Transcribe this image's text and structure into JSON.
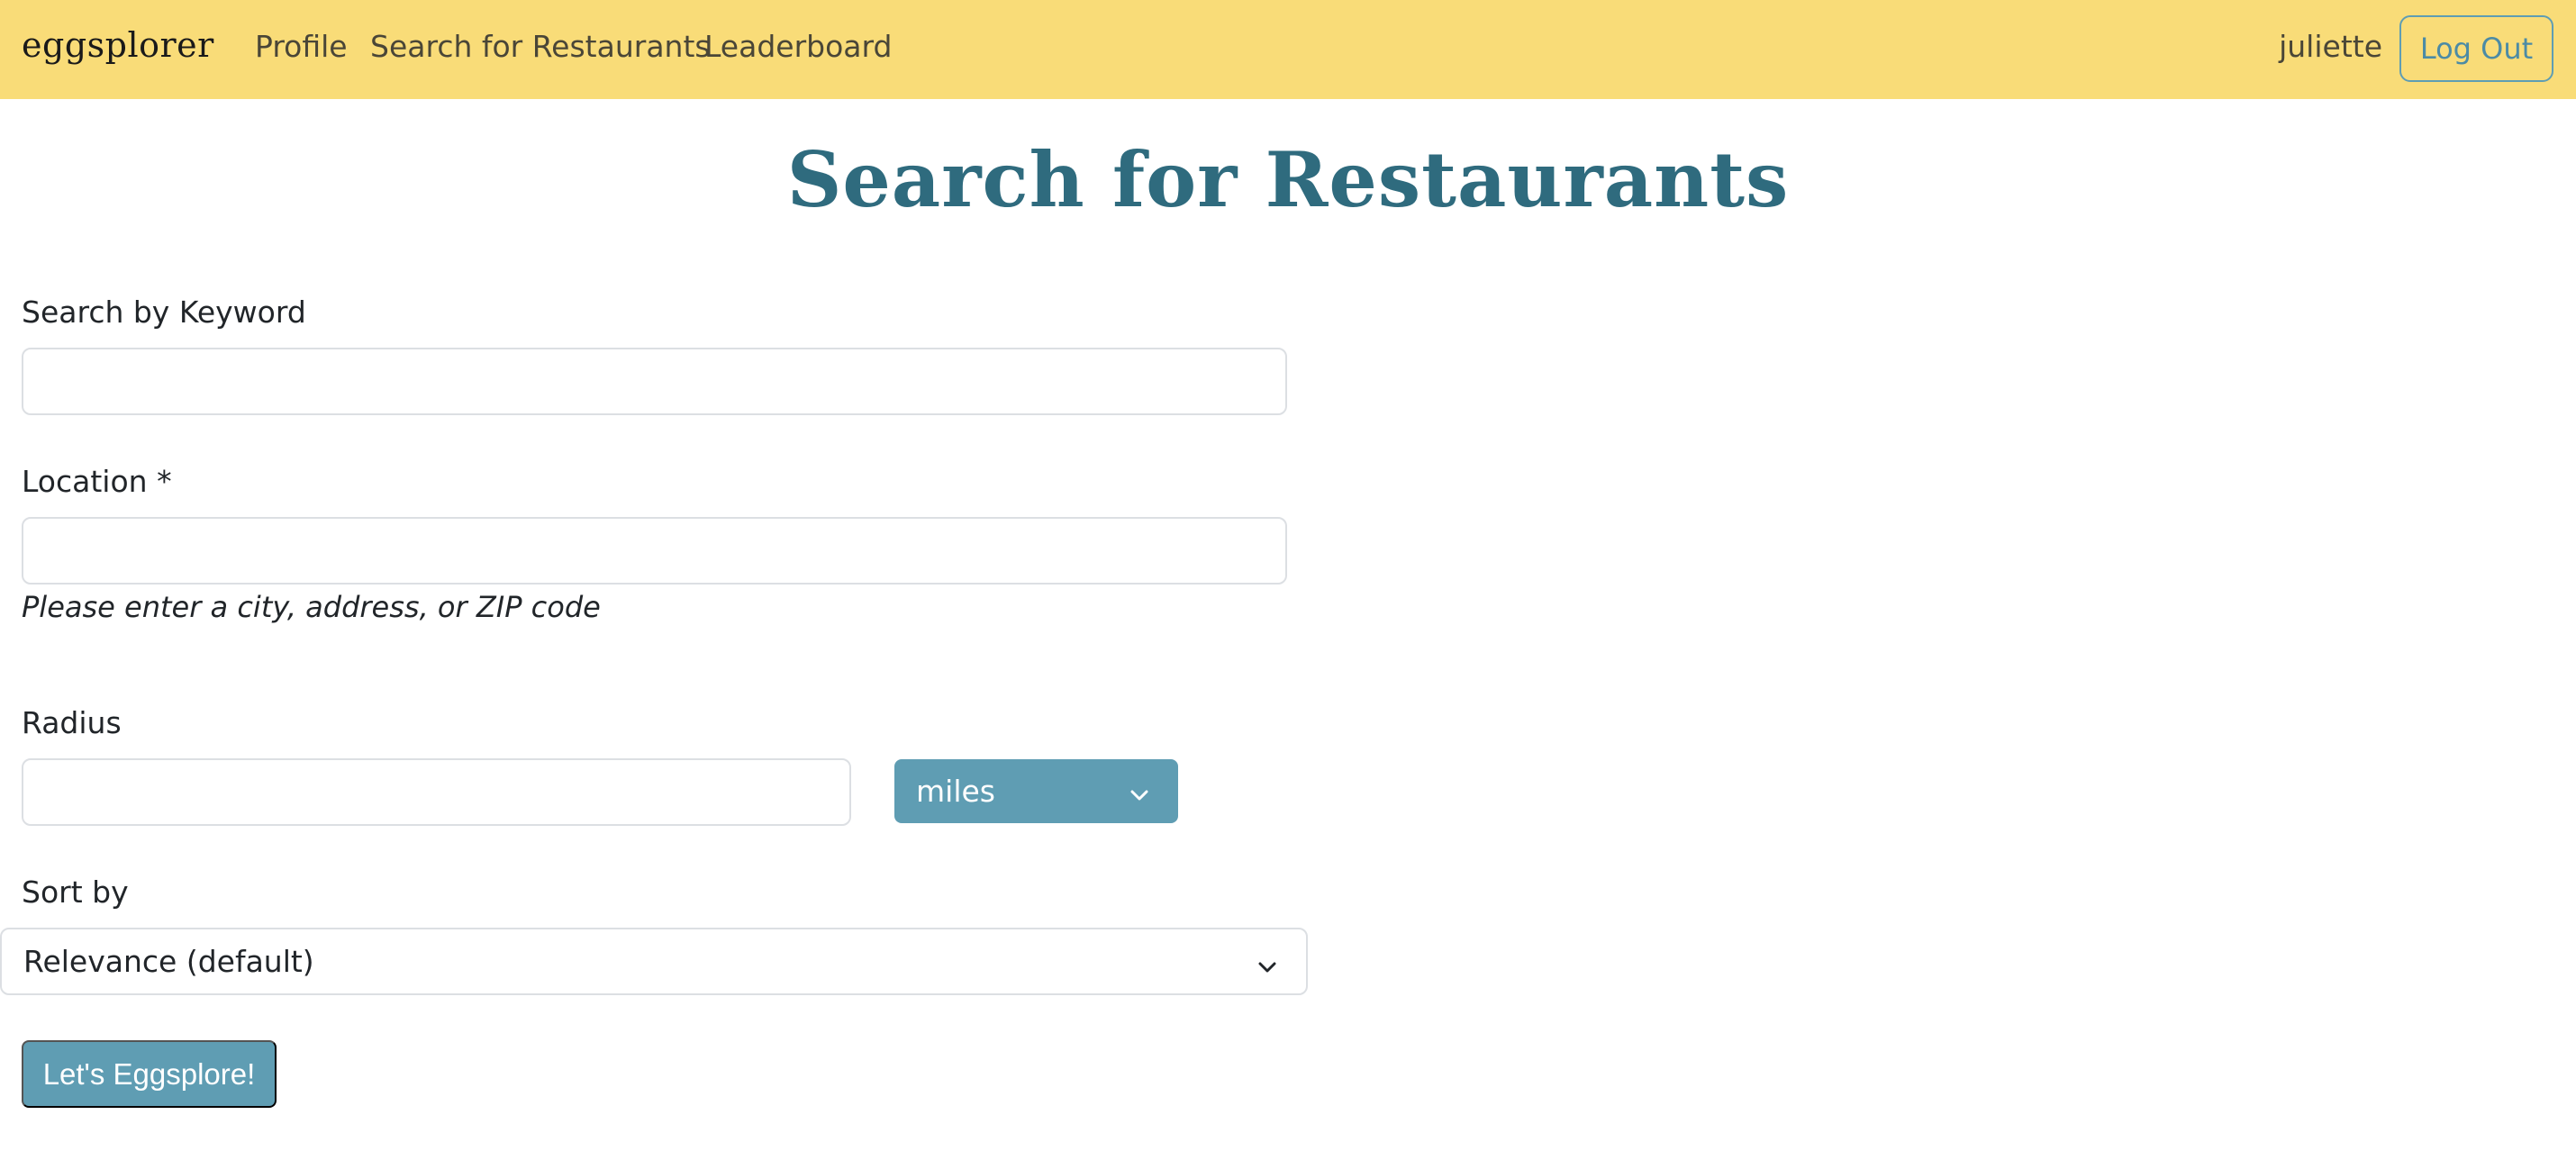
{
  "navbar": {
    "brand": "eggsplorer",
    "links": {
      "profile": "Profile",
      "search": "Search for Restaurants",
      "leaderboard": "Leaderboard"
    },
    "username": "juliette",
    "logout_label": "Log Out"
  },
  "page": {
    "title": "Search for Restaurants"
  },
  "form": {
    "keyword": {
      "label": "Search by Keyword",
      "value": ""
    },
    "location": {
      "label": "Location *",
      "value": "",
      "help": "Please enter a city, address, or ZIP code"
    },
    "radius": {
      "label": "Radius",
      "value": "",
      "unit_selected": "miles"
    },
    "sort": {
      "label": "Sort by",
      "selected": "Relevance (default)"
    },
    "submit_label": "Let's Eggsplore!"
  },
  "colors": {
    "navbar_bg": "#f9dc78",
    "accent": "#5f9db3",
    "title": "#2f6b7e"
  },
  "icons": {
    "units_dropdown": "chevron-down-icon",
    "sort_dropdown": "chevron-down-icon"
  }
}
